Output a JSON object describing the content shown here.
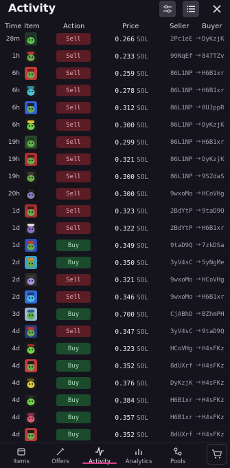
{
  "header": {
    "title": "Activity"
  },
  "columns": {
    "time": "Time",
    "item": "Item",
    "action": "Action",
    "price": "Price",
    "seller": "Seller",
    "buyer": "Buyer"
  },
  "currency": "SOL",
  "arrow": "→",
  "rows": [
    {
      "time": "28m",
      "action": "Sell",
      "price": "0.266",
      "seller": "2Pc1eE",
      "buyer": "DyKzjK",
      "avatar": {
        "bg": "#1f3a2a",
        "body": "#5fbf4a",
        "hat": "#2a2a2a"
      }
    },
    {
      "time": "1h",
      "action": "Sell",
      "price": "0.233",
      "seller": "99NqEf",
      "buyer": "847TZv",
      "avatar": {
        "bg": "#1a1a1a",
        "body": "#6aa84f",
        "hat": "#c0392b"
      }
    },
    {
      "time": "6h",
      "action": "Sell",
      "price": "0.259",
      "seller": "86L1NP",
      "buyer": "H6B1xr",
      "avatar": {
        "bg": "#c23b3b",
        "body": "#6aa84f",
        "hat": "#7a1f1f"
      }
    },
    {
      "time": "6h",
      "action": "Sell",
      "price": "0.278",
      "seller": "86L1NP",
      "buyer": "H6B1xr",
      "avatar": {
        "bg": "#1a1a1a",
        "body": "#4fc3d4",
        "hat": "#2a8a9a"
      }
    },
    {
      "time": "6h",
      "action": "Sell",
      "price": "0.312",
      "seller": "86L1NP",
      "buyer": "8UJppR",
      "avatar": {
        "bg": "#2e5fd8",
        "body": "#6aa84f",
        "hat": "#222222"
      }
    },
    {
      "time": "6h",
      "action": "Sell",
      "price": "0.300",
      "seller": "86L1NP",
      "buyer": "DyKzjK",
      "avatar": {
        "bg": "#1a1a1a",
        "body": "#6fd14a",
        "hat": "#e6c13a"
      }
    },
    {
      "time": "19h",
      "action": "Sell",
      "price": "0.299",
      "seller": "86L1NP",
      "buyer": "H6B1xr",
      "avatar": {
        "bg": "#2d4a2a",
        "body": "#5fae4a",
        "hat": "#1f3a1f"
      }
    },
    {
      "time": "19h",
      "action": "Sell",
      "price": "0.321",
      "seller": "86L1NP",
      "buyer": "DyKzjK",
      "avatar": {
        "bg": "#b03030",
        "body": "#6aa84f",
        "hat": "#5a1a1a"
      }
    },
    {
      "time": "19h",
      "action": "Sell",
      "price": "0.300",
      "seller": "86L1NP",
      "buyer": "9SZdaS",
      "avatar": {
        "bg": "#1a1a1a",
        "body": "#6aa84f",
        "hat": "#3a3a3a"
      }
    },
    {
      "time": "20h",
      "action": "Sell",
      "price": "0.300",
      "seller": "9wxoMo",
      "buyer": "HCoVHg",
      "avatar": {
        "bg": "#111111",
        "body": "#8a7ab8",
        "hat": "#222222"
      }
    },
    {
      "time": "1d",
      "action": "Sell",
      "price": "0.323",
      "seller": "2BdYtP",
      "buyer": "9taD9Q",
      "avatar": {
        "bg": "#a83232",
        "body": "#6aa84f",
        "hat": "#4a1a1a"
      }
    },
    {
      "time": "1d",
      "action": "Sell",
      "price": "0.322",
      "seller": "2BdYtP",
      "buyer": "H6B1xr",
      "avatar": {
        "bg": "#1a1a1a",
        "body": "#8d6fc8",
        "hat": "#e0e0e0"
      }
    },
    {
      "time": "1d",
      "action": "Buy",
      "price": "0.349",
      "seller": "9taD9Q",
      "buyer": "7zkDSa",
      "avatar": {
        "bg": "#2a4fb8",
        "body": "#6aa84f",
        "hat": "#c0392b"
      }
    },
    {
      "time": "2d",
      "action": "Buy",
      "price": "0.350",
      "seller": "3yV4sC",
      "buyer": "5yNgMe",
      "avatar": {
        "bg": "#3aa0c8",
        "body": "#6aa84f",
        "hat": "#d08a2a"
      }
    },
    {
      "time": "2d",
      "action": "Sell",
      "price": "0.321",
      "seller": "9wxoMo",
      "buyer": "HCoVHg",
      "avatar": {
        "bg": "#2a2a2a",
        "body": "#a88fd8",
        "hat": "#3a3a3a"
      }
    },
    {
      "time": "2d",
      "action": "Sell",
      "price": "0.346",
      "seller": "9wxoMo",
      "buyer": "H6B1xr",
      "avatar": {
        "bg": "#2e6fd8",
        "body": "#4fb8e0",
        "hat": "#1f3a7a"
      }
    },
    {
      "time": "3d",
      "action": "Buy",
      "price": "0.700",
      "seller": "CjABhD",
      "buyer": "BZhmPH",
      "avatar": {
        "bg": "#9ab8d8",
        "body": "#5fae4a",
        "hat": "#3a5a8a"
      }
    },
    {
      "time": "4d",
      "action": "Sell",
      "price": "0.347",
      "seller": "3yV4sC",
      "buyer": "9taD9Q",
      "avatar": {
        "bg": "#2a3a7a",
        "body": "#6aa84f",
        "hat": "#c0392b"
      }
    },
    {
      "time": "4d",
      "action": "Buy",
      "price": "0.323",
      "seller": "HCoVHg",
      "buyer": "H4sFKz",
      "avatar": {
        "bg": "#1a1a1a",
        "body": "#6fd14a",
        "hat": "#8a2a2a"
      }
    },
    {
      "time": "4d",
      "action": "Buy",
      "price": "0.352",
      "seller": "8dUXrf",
      "buyer": "H4sFKz",
      "avatar": {
        "bg": "#c23b3b",
        "body": "#6aa84f",
        "hat": "#1a1a1a"
      }
    },
    {
      "time": "4d",
      "action": "Buy",
      "price": "0.376",
      "seller": "DyKzjK",
      "buyer": "H4sFKz",
      "avatar": {
        "bg": "#1a1a1a",
        "body": "#d8c84a",
        "hat": "#6a5a1a"
      }
    },
    {
      "time": "4d",
      "action": "Buy",
      "price": "0.384",
      "seller": "H6B1xr",
      "buyer": "H4sFKz",
      "avatar": {
        "bg": "#1a1a1a",
        "body": "#6fd14a",
        "hat": "#2a2a2a"
      }
    },
    {
      "time": "4d",
      "action": "Buy",
      "price": "0.357",
      "seller": "H6B1xr",
      "buyer": "H4sFKz",
      "avatar": {
        "bg": "#1a1a1a",
        "body": "#d85a7a",
        "hat": "#8a2a4a"
      }
    },
    {
      "time": "4d",
      "action": "Buy",
      "price": "0.352",
      "seller": "8dUXrf",
      "buyer": "H4sFKz",
      "avatar": {
        "bg": "#b83a3a",
        "body": "#6aa84f",
        "hat": "#1a1a1a"
      }
    }
  ],
  "nav": [
    {
      "label": "Items",
      "icon": "items-icon",
      "active": false
    },
    {
      "label": "Offers",
      "icon": "offers-icon",
      "active": false
    },
    {
      "label": "Activity",
      "icon": "activity-icon",
      "active": true
    },
    {
      "label": "Analytics",
      "icon": "analytics-icon",
      "active": false
    },
    {
      "label": "Pools",
      "icon": "pools-icon",
      "active": false
    }
  ],
  "colors": {
    "accent": "#e0408a",
    "sell_bg": "#5a1c25",
    "buy_bg": "#1c4a2d",
    "background": "#15131c"
  }
}
